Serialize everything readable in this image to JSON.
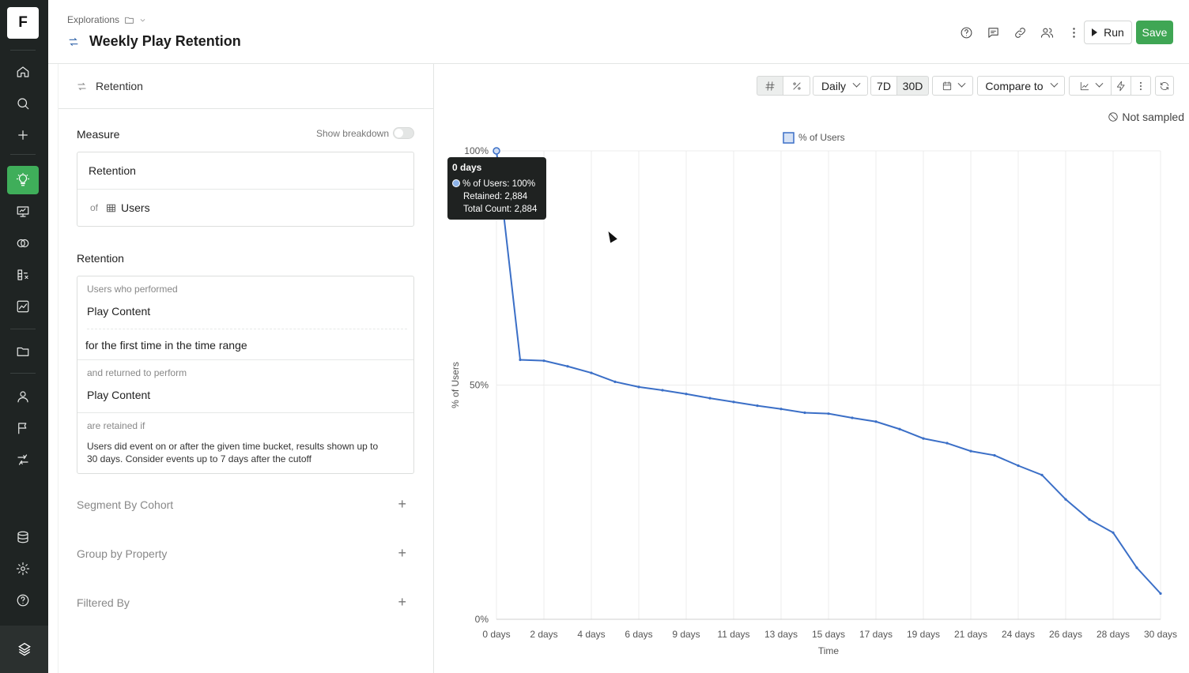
{
  "rail": {
    "logo": "F",
    "items": [
      "home-icon",
      "search-icon",
      "plus-icon",
      "lightbulb-icon",
      "presentation-icon",
      "rings-icon",
      "metrics-icon",
      "chart-icon",
      "folder-icon",
      "user-icon",
      "flag-icon",
      "experiment-icon",
      "database-icon",
      "gear-icon",
      "help-icon"
    ],
    "active": "lightbulb-icon",
    "bottom_logo": "brand-icon"
  },
  "header": {
    "breadcrumb": "Explorations",
    "title": "Weekly Play Retention",
    "run_label": "Run",
    "save_label": "Save",
    "icons": [
      "help-icon",
      "comment-icon",
      "link-icon",
      "users-icon",
      "more-icon"
    ],
    "save_color": "#3fa654"
  },
  "left": {
    "header_label": "Retention",
    "measure": {
      "title": "Measure",
      "show_breakdown_label": "Show breakdown",
      "metric": "Retention",
      "of_label": "of",
      "entity": "Users"
    },
    "retention": {
      "title": "Retention",
      "performed_label": "Users who performed",
      "performed_event": "Play Content",
      "first_time_text": "for the first time in the time range",
      "returned_label": "and returned to perform",
      "returned_event": "Play Content",
      "retained_label": "are retained if",
      "retained_text": "Users did event on or after the given time bucket, results shown up to 30 days. Consider events up to 7 days after the cutoff"
    },
    "segment_by_cohort": "Segment By Cohort",
    "group_by_property": "Group by Property",
    "filtered_by": "Filtered By"
  },
  "toolbar": {
    "granularity": "Daily",
    "range_7d": "7D",
    "range_30d": "30D",
    "compare_to": "Compare to",
    "not_sampled": "Not sampled"
  },
  "tooltip": {
    "title": "0 days",
    "line1": "% of Users: 100%",
    "line2": "Retained: 2,884",
    "line3": "Total Count: 2,884"
  },
  "chart_data": {
    "type": "line",
    "legend": [
      "% of Users"
    ],
    "xlabel": "Time",
    "ylabel": "% of Users",
    "ylim": [
      0,
      100
    ],
    "ytick_labels": [
      "0%",
      "50%",
      "100%"
    ],
    "xlim": [
      0,
      28
    ],
    "xtick_labels": [
      "0 days",
      "2 days",
      "4 days",
      "6 days",
      "9 days",
      "11 days",
      "13 days",
      "15 days",
      "17 days",
      "19 days",
      "21 days",
      "24 days",
      "26 days",
      "28 days",
      "30 days"
    ],
    "color": "#3b6fc7",
    "series": [
      {
        "name": "% of Users",
        "x": [
          0,
          1,
          2,
          3,
          4,
          5,
          6,
          7,
          8,
          9,
          10,
          11,
          12,
          13,
          14,
          15,
          16,
          17,
          18,
          19,
          20,
          21,
          22,
          23,
          24,
          25,
          26,
          27,
          28
        ],
        "y": [
          100,
          55.4,
          55.2,
          54.0,
          52.6,
          50.7,
          49.6,
          48.9,
          48.1,
          47.2,
          46.4,
          45.6,
          44.9,
          44.1,
          43.9,
          43.0,
          42.2,
          40.6,
          38.6,
          37.6,
          35.9,
          35.0,
          32.8,
          30.8,
          25.6,
          21.3,
          18.5,
          11.0,
          5.5
        ]
      }
    ],
    "grid": true,
    "legend_position": "top-center"
  }
}
